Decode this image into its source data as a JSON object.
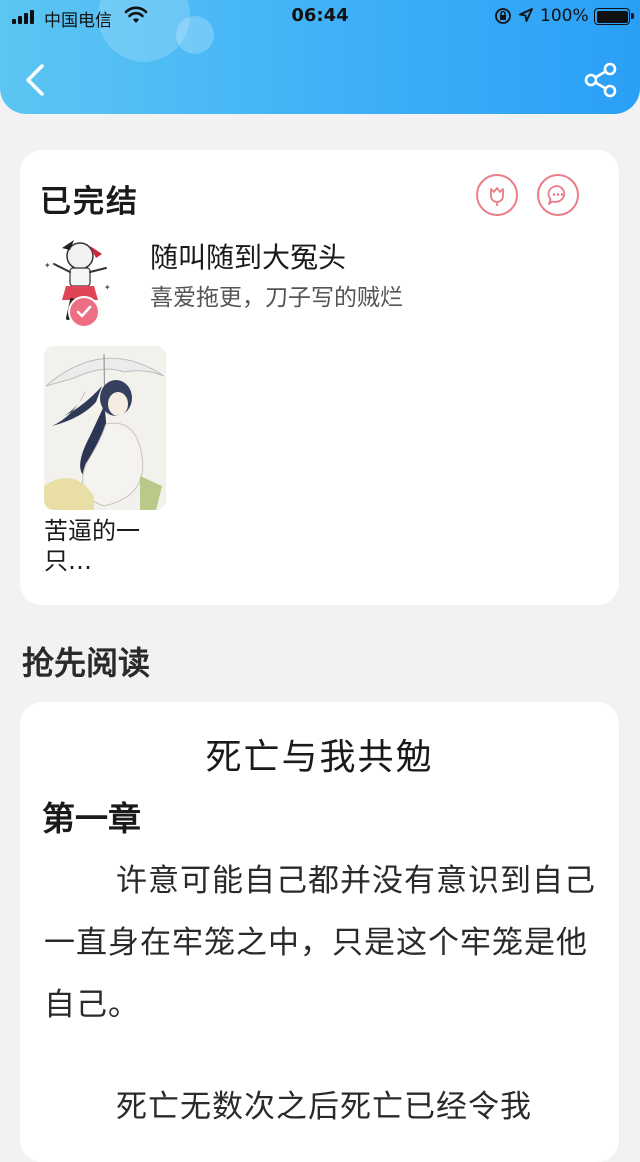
{
  "status_bar": {
    "carrier": "中国电信",
    "time": "06:44",
    "battery": "100%"
  },
  "nav": {
    "back_icon": "chevron-left-icon",
    "share_icon": "share-icon"
  },
  "colors": {
    "header_gradient_start": "#5cc6f2",
    "header_gradient_end": "#2a9ff5",
    "accent_pink": "#ee6f84"
  },
  "author_card": {
    "status_label": "已完结",
    "flower_icon": "flower-icon",
    "comment_icon": "comment-icon",
    "author_name": "随叫随到大冤头",
    "author_signature": "喜爱拖更，刀子写的贼烂",
    "book_title": "苦逼的一只…"
  },
  "preview": {
    "section_title": "抢先阅读",
    "novel_title": "死亡与我共勉",
    "chapter": "第一章",
    "paragraphs": [
      "许意可能自己都并没有意识到自己一直身在牢笼之中，只是这个牢笼是他自己。",
      "死亡无数次之后死亡已经令我"
    ]
  }
}
